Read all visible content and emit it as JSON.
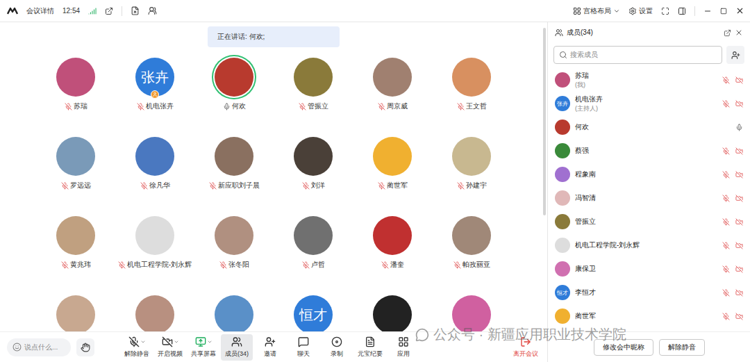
{
  "window": {
    "title": "会议详情",
    "time": "12:54"
  },
  "top_bar": {
    "layout": "宫格布局",
    "settings": "设置"
  },
  "speaking": "正在讲话: 何欢;",
  "grid": [
    {
      "name": "苏瑞",
      "avatar_text": "",
      "muted": true,
      "speaking": false,
      "host": false,
      "color": "#c0507a"
    },
    {
      "name": "机电张卉",
      "avatar_text": "张卉",
      "muted": true,
      "speaking": false,
      "host": true,
      "color": "#2f7cd9"
    },
    {
      "name": "何欢",
      "avatar_text": "",
      "muted": false,
      "speaking": true,
      "host": false,
      "color": "#b83a2e"
    },
    {
      "name": "管振立",
      "avatar_text": "",
      "muted": true,
      "speaking": false,
      "host": false,
      "color": "#8a7a3a"
    },
    {
      "name": "周京威",
      "avatar_text": "",
      "muted": true,
      "speaking": false,
      "host": false,
      "color": "#a08070"
    },
    {
      "name": "王文哲",
      "avatar_text": "",
      "muted": true,
      "speaking": false,
      "host": false,
      "color": "#d89060"
    },
    {
      "name": "罗远远",
      "avatar_text": "",
      "muted": true,
      "speaking": false,
      "host": false,
      "color": "#7a9ab8"
    },
    {
      "name": "徐凡华",
      "avatar_text": "",
      "muted": true,
      "speaking": false,
      "host": false,
      "color": "#4a78c0"
    },
    {
      "name": "新应职刘子晨",
      "avatar_text": "",
      "muted": true,
      "speaking": false,
      "host": false,
      "color": "#8a7060"
    },
    {
      "name": "刘洋",
      "avatar_text": "",
      "muted": true,
      "speaking": false,
      "host": false,
      "color": "#4a4038"
    },
    {
      "name": "蔺世军",
      "avatar_text": "",
      "muted": true,
      "speaking": false,
      "host": false,
      "color": "#f0b030"
    },
    {
      "name": "孙建宇",
      "avatar_text": "",
      "muted": true,
      "speaking": false,
      "host": false,
      "color": "#c8b890"
    },
    {
      "name": "黄兆玮",
      "avatar_text": "",
      "muted": true,
      "speaking": false,
      "host": false,
      "color": "#c0a080"
    },
    {
      "name": "机电工程学院-刘永辉",
      "avatar_text": "",
      "muted": true,
      "speaking": false,
      "host": false,
      "color": "#dddddd"
    },
    {
      "name": "张冬阳",
      "avatar_text": "",
      "muted": true,
      "speaking": false,
      "host": false,
      "color": "#b09080"
    },
    {
      "name": "卢哲",
      "avatar_text": "",
      "muted": true,
      "speaking": false,
      "host": false,
      "color": "#707070"
    },
    {
      "name": "潘奎",
      "avatar_text": "",
      "muted": true,
      "speaking": false,
      "host": false,
      "color": "#c03030"
    },
    {
      "name": "帕孜丽亚",
      "avatar_text": "",
      "muted": true,
      "speaking": false,
      "host": false,
      "color": "#a08878"
    }
  ],
  "grid_partial": [
    {
      "avatar_text": "",
      "color": "#c8a890"
    },
    {
      "avatar_text": "",
      "color": "#b89080"
    },
    {
      "avatar_text": "",
      "color": "#5a90c8"
    },
    {
      "avatar_text": "恒才",
      "color": "#2f7cd9"
    },
    {
      "avatar_text": "",
      "color": "#222222"
    },
    {
      "avatar_text": "",
      "color": "#d060a0"
    }
  ],
  "bottom_bar": {
    "chat_placeholder": "说点什么...",
    "buttons": [
      {
        "label": "解除静音",
        "kind": "mic",
        "menu": true,
        "selected": false
      },
      {
        "label": "开启视频",
        "kind": "video",
        "menu": true,
        "selected": false
      },
      {
        "label": "共享屏幕",
        "kind": "share",
        "menu": true,
        "selected": false
      },
      {
        "label": "成员(34)",
        "kind": "members",
        "menu": false,
        "selected": true
      },
      {
        "label": "邀请",
        "kind": "invite",
        "menu": false,
        "selected": false
      },
      {
        "label": "聊天",
        "kind": "chat",
        "menu": false,
        "selected": false
      },
      {
        "label": "录制",
        "kind": "record",
        "menu": false,
        "selected": false
      },
      {
        "label": "元宝纪要",
        "kind": "summary",
        "menu": false,
        "selected": false
      },
      {
        "label": "应用",
        "kind": "apps",
        "menu": false,
        "selected": false
      }
    ],
    "leave": "离开会议"
  },
  "watermark": "公众号 · 新疆应用职业技术学院",
  "members_panel": {
    "title": "成员(34)",
    "search_placeholder": "搜索成员",
    "members": [
      {
        "name": "苏瑞",
        "note": "(我)",
        "avatar_text": "",
        "muted": true,
        "video_off": true,
        "color": "#c0507a"
      },
      {
        "name": "机电张卉",
        "note": "(主持人)",
        "avatar_text": "张卉",
        "muted": true,
        "video_off": true,
        "color": "#2f7cd9"
      },
      {
        "name": "何欢",
        "note": "",
        "avatar_text": "",
        "muted": false,
        "video_off": false,
        "color": "#b83a2e"
      },
      {
        "name": "蔡强",
        "note": "",
        "avatar_text": "",
        "muted": true,
        "video_off": true,
        "color": "#3a8a3a"
      },
      {
        "name": "程象南",
        "note": "",
        "avatar_text": "",
        "muted": true,
        "video_off": true,
        "color": "#a070d0"
      },
      {
        "name": "冯智清",
        "note": "",
        "avatar_text": "",
        "muted": true,
        "video_off": true,
        "color": "#e0b8b8"
      },
      {
        "name": "管振立",
        "note": "",
        "avatar_text": "",
        "muted": true,
        "video_off": true,
        "color": "#8a7a3a"
      },
      {
        "name": "机电工程学院-刘永辉",
        "note": "",
        "avatar_text": "",
        "muted": true,
        "video_off": true,
        "color": "#dddddd"
      },
      {
        "name": "康保卫",
        "note": "",
        "avatar_text": "",
        "muted": true,
        "video_off": true,
        "color": "#d070b0"
      },
      {
        "name": "李恒才",
        "note": "",
        "avatar_text": "恒才",
        "muted": true,
        "video_off": true,
        "color": "#2f7cd9"
      },
      {
        "name": "蔺世军",
        "note": "",
        "avatar_text": "",
        "muted": true,
        "video_off": true,
        "color": "#f0b030"
      }
    ],
    "buttons": [
      "修改会中昵称",
      "解除静音"
    ]
  }
}
